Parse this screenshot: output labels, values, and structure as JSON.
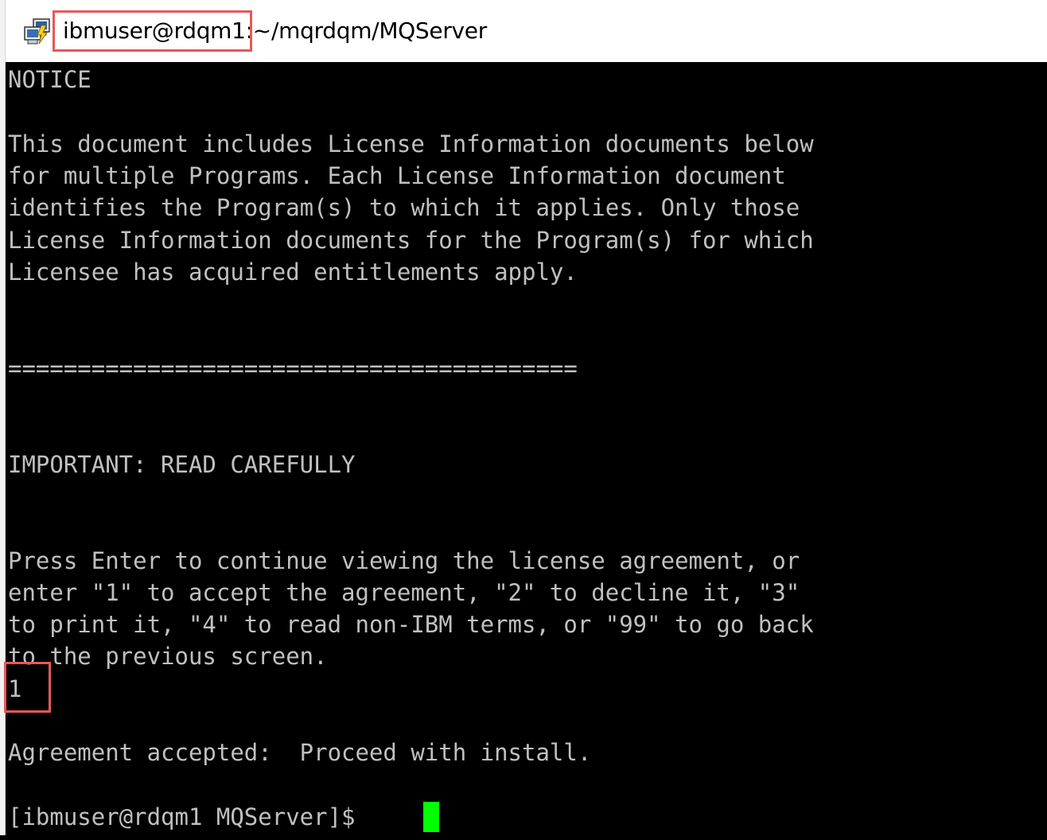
{
  "window": {
    "title_host": "ibmuser@rdqm1:",
    "title_path": "~/mqrdqm/MQServer"
  },
  "terminal": {
    "lines": [
      "NOTICE",
      "",
      "This document includes License Information documents below",
      "for multiple Programs. Each License Information document",
      "identifies the Program(s) to which it applies. Only those",
      "License Information documents for the Program(s) for which",
      "Licensee has acquired entitlements apply.",
      "",
      "",
      "=========================================",
      "",
      "",
      "IMPORTANT: READ CAREFULLY",
      "",
      "",
      "Press Enter to continue viewing the license agreement, or",
      "enter \"1\" to accept the agreement, \"2\" to decline it, \"3\"",
      "to print it, \"4\" to read non-IBM terms, or \"99\" to go back",
      "to the previous screen.",
      "1",
      "",
      "Agreement accepted:  Proceed with install.",
      "",
      "[ibmuser@rdqm1 MQServer]$ "
    ]
  },
  "colors": {
    "terminal_bg": "#000000",
    "terminal_fg": "#c0c0c0",
    "cursor": "#00ff00",
    "highlight": "#e8575a"
  },
  "icons": {
    "app": "putty-icon"
  }
}
